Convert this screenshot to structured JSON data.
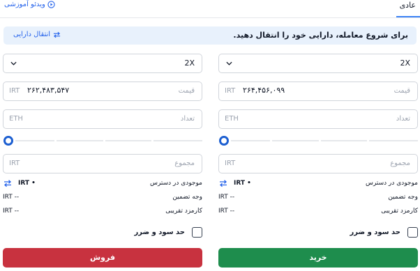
{
  "tabs": {
    "normal": "عادی",
    "video_tutorial": "ویدئو آموزشی"
  },
  "banner": {
    "text": "برای شروع معامله، دارایی خود را انتقال دهید.",
    "transfer_link": "انتقال دارایی"
  },
  "buy": {
    "leverage": "2X",
    "price_label": "قیمت",
    "price_value": "۲۶۴,۴۵۶,۰۹۹",
    "price_unit": "IRT",
    "amount_label": "تعداد",
    "amount_unit": "ETH",
    "total_label": "مجموع",
    "total_unit": "IRT",
    "available_label": "موجودی در دسترس",
    "available_value": "IRT •",
    "margin_label": "وجه تضمین",
    "margin_value": "IRT --",
    "fee_label": "کارمزد تقریبی",
    "fee_value": "IRT --",
    "tp_sl_label": "حد سود و ضرر",
    "button_label": "خرید"
  },
  "sell": {
    "leverage": "2X",
    "price_label": "قیمت",
    "price_value": "۲۶۲,۴۸۳,۵۴۷",
    "price_unit": "IRT",
    "amount_label": "تعداد",
    "amount_unit": "ETH",
    "total_label": "مجموع",
    "total_unit": "IRT",
    "available_label": "موجودی در دسترس",
    "available_value": "IRT •",
    "margin_label": "وجه تضمین",
    "margin_value": "IRT --",
    "fee_label": "کارمزد تقریبی",
    "fee_value": "IRT --",
    "tp_sl_label": "حد سود و ضرر",
    "button_label": "فروش"
  },
  "colors": {
    "accent": "#2563eb",
    "buy": "#1e8d4d",
    "sell": "#c8323f",
    "banner_bg": "#e8f1fc"
  },
  "icons": {
    "video": "play-circle-icon",
    "transfer": "swap-arrows-icon",
    "dropdown": "chevron-down-icon"
  }
}
